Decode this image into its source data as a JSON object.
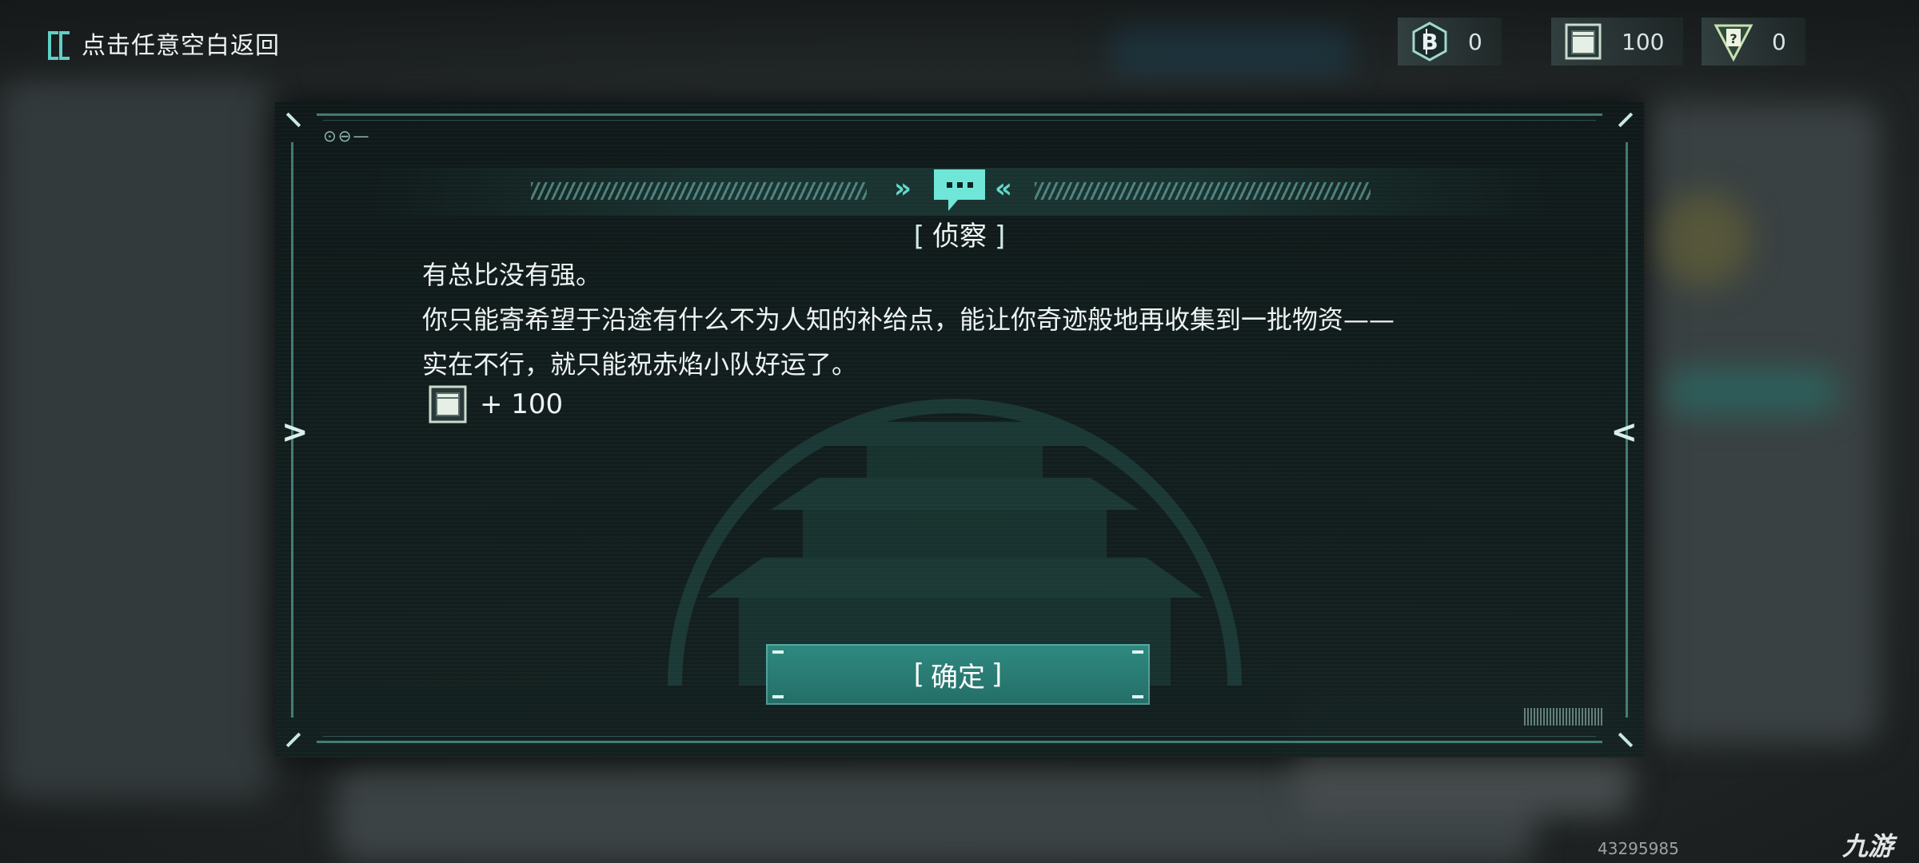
{
  "header": {
    "back_label": "点击任意空白返回"
  },
  "resources": [
    {
      "icon": "coin-b-icon",
      "value": "0"
    },
    {
      "icon": "supply-crate-icon",
      "value": "100"
    },
    {
      "icon": "mystery-card-icon",
      "value": "0"
    }
  ],
  "dialog": {
    "title_open": "[",
    "title": "侦察",
    "title_close": "]",
    "lines": [
      "有总比没有强。",
      "你只能寄希望于沿途有什么不为人知的补给点，能让你奇迹般地再收集到一批物资——",
      "实在不行，就只能祝赤焰小队好运了。"
    ],
    "reward": {
      "icon": "supply-crate-icon",
      "value": "+ 100"
    },
    "confirm_open": "[",
    "confirm_label": "确定",
    "confirm_close": "]",
    "corner_mark": "⊙⊖—"
  },
  "footer": {
    "id_text": "43295985",
    "watermark_logo": "九游"
  },
  "colors": {
    "accent": "#5fd0c4",
    "button": "#2b8078",
    "dialog_bg": "#0f1a1a"
  }
}
